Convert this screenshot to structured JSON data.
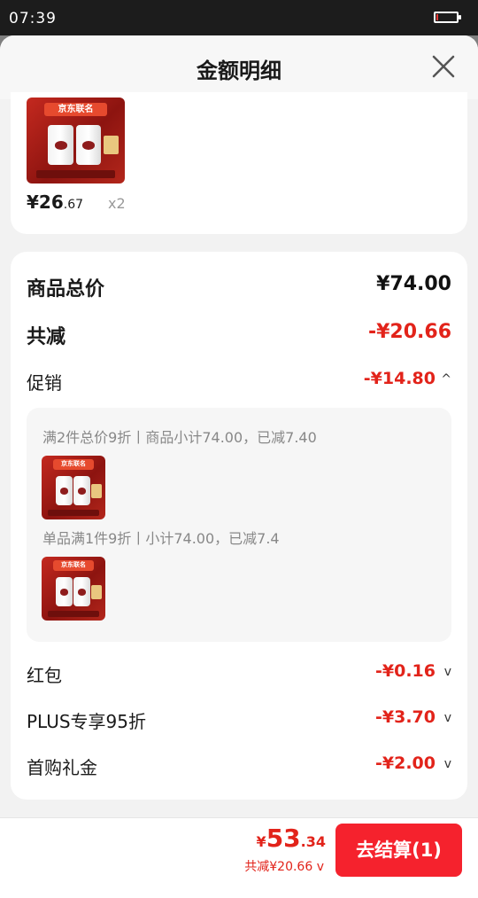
{
  "status_bar": {
    "time": "07:39",
    "battery_level": 0.1
  },
  "sheet": {
    "title": "金额明细",
    "close_icon": "close-icon"
  },
  "product": {
    "image_text": "京东联名",
    "price_int": "¥26",
    "price_cents": ".67",
    "quantity": "x2"
  },
  "summary": {
    "total_label": "商品总价",
    "total_value": "¥74.00",
    "reduce_label": "共减",
    "reduce_value": "-¥20.66"
  },
  "promotion": {
    "label": "促销",
    "value": "-¥14.80",
    "chevron": "^",
    "items": [
      {
        "text": "满2件总价9折丨商品小计74.00，已减7.40"
      },
      {
        "text": "单品满1件9折丨小计74.00，已减7.4"
      }
    ]
  },
  "discounts": [
    {
      "label": "红包",
      "value": "-¥0.16",
      "chevron": "v"
    },
    {
      "label": "PLUS专享95折",
      "value": "-¥3.70",
      "chevron": "v"
    },
    {
      "label": "首购礼金",
      "value": "-¥2.00",
      "chevron": "v"
    }
  ],
  "bottom_bar": {
    "currency": "¥",
    "total_int": "53",
    "total_cents": ".34",
    "reduce_text": "共减¥20.66",
    "reduce_chevron": "v",
    "checkout_label": "去结算(1)"
  },
  "colors": {
    "accent": "#e2231a",
    "button": "#f5222d",
    "sheet_bg": "#f2f2f2"
  }
}
